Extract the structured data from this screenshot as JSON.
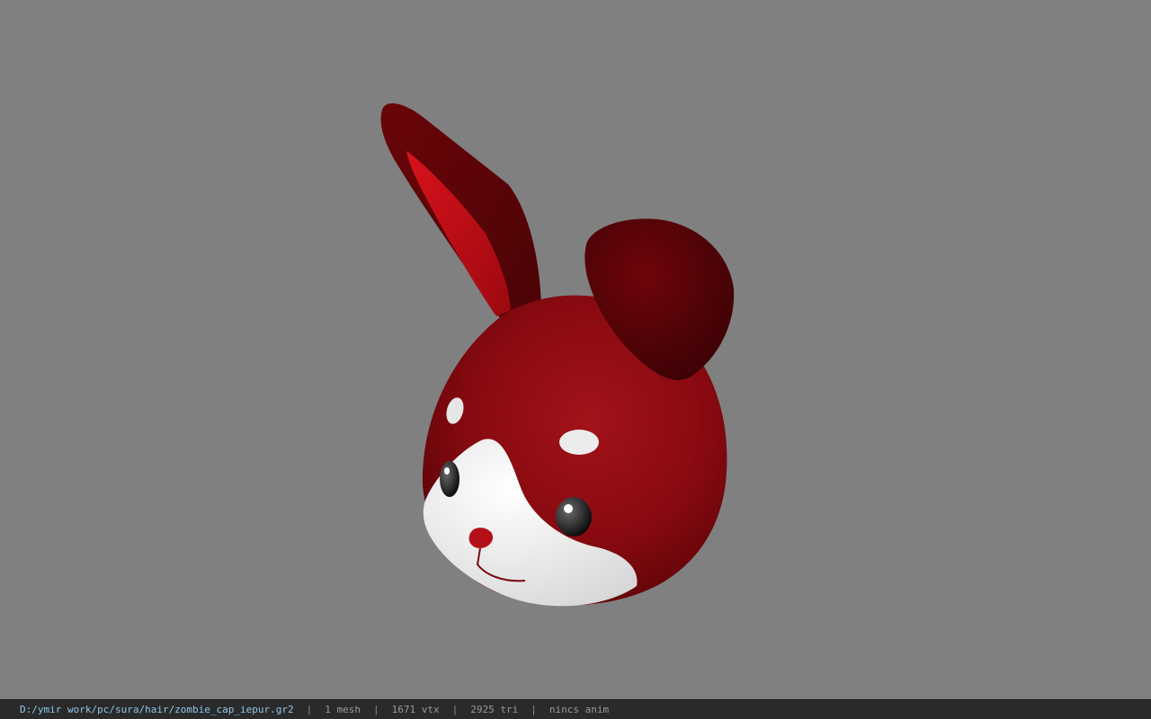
{
  "viewport": {
    "background": "#808080",
    "model": "rabbit-head-model"
  },
  "status": {
    "file_path": "D:/ymir work/pc/sura/hair/zombie_cap_iepur.gr2",
    "separator": "|",
    "mesh_count": "1 mesh",
    "vertex_count": "1671 vtx",
    "triangle_count": "2925 tri",
    "animation": "nincs anim"
  },
  "colors": {
    "fur": "#8e0a0d",
    "fur_dark": "#5a0407",
    "inner_ear": "#c40b12",
    "white_patch": "#f2f2f2",
    "status_bar": "#2a2a2a",
    "path_text": "#8fc7e8"
  }
}
